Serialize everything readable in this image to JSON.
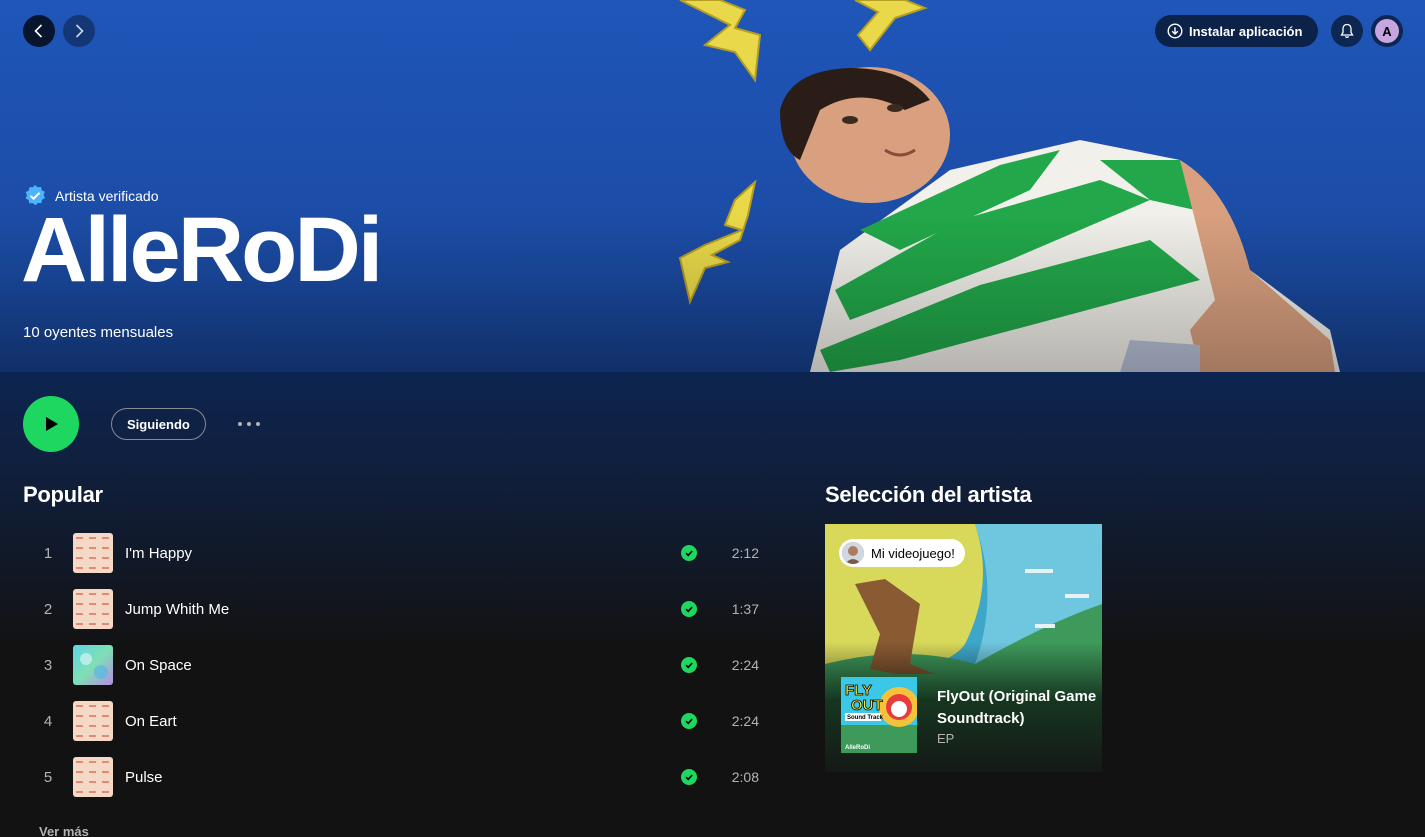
{
  "nav": {
    "back_icon": "chevron-left-icon",
    "forward_icon": "chevron-right-icon"
  },
  "topbar": {
    "install_label": "Instalar aplicación",
    "install_icon": "download-circle-icon",
    "bell_icon": "bell-icon",
    "avatar_letter": "A"
  },
  "artist": {
    "verified_label": "Artista verificado",
    "name": "AlleRoDi",
    "listeners": "10 oyentes mensuales"
  },
  "actions": {
    "follow_label": "Siguiendo"
  },
  "popular": {
    "title": "Popular",
    "tracks": [
      {
        "num": "1",
        "title": "I'm Happy",
        "duration": "2:12"
      },
      {
        "num": "2",
        "title": "Jump Whith Me",
        "duration": "1:37"
      },
      {
        "num": "3",
        "title": "On Space",
        "duration": "2:24"
      },
      {
        "num": "4",
        "title": "On Eart",
        "duration": "2:24"
      },
      {
        "num": "5",
        "title": "Pulse",
        "duration": "2:08"
      }
    ],
    "see_more": "Ver más"
  },
  "artist_pick": {
    "title": "Selección del artista",
    "badge": "Mi videojuego!",
    "album_title": "FlyOut (Original Game Soundtrack)",
    "album_type": "EP",
    "cover_text_1": "FLY",
    "cover_text_2": "OUT",
    "cover_text_3": "Sound Track",
    "cover_text_4": "AlleRoDi"
  },
  "colors": {
    "accent": "#1ed760",
    "hero_blue": "#1f56b8"
  }
}
